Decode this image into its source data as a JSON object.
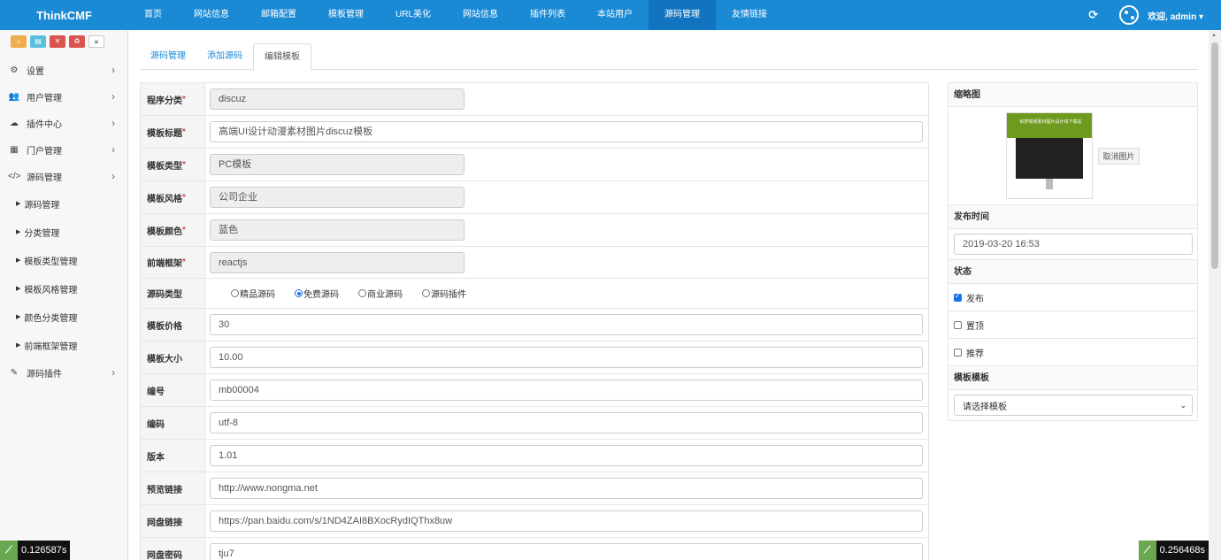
{
  "brand": "ThinkCMF",
  "nav": [
    "首页",
    "网站信息",
    "邮箱配置",
    "模板管理",
    "URL美化",
    "网站信息",
    "插件列表",
    "本站用户",
    "源码管理",
    "友情链接"
  ],
  "nav_active_index": 8,
  "user_menu": {
    "welcome": "欢迎, admin ▾"
  },
  "sidebar": {
    "shortcuts": [
      "home-icon",
      "file-icon",
      "trash-icon",
      "recycle-icon",
      "list-icon"
    ],
    "menu": [
      {
        "label": "设置",
        "icon": "cogs-icon"
      },
      {
        "label": "用户管理",
        "icon": "users-icon"
      },
      {
        "label": "插件中心",
        "icon": "cloud-icon"
      },
      {
        "label": "门户管理",
        "icon": "grid-icon"
      },
      {
        "label": "源码管理",
        "icon": "code-icon"
      }
    ],
    "submenu": [
      "源码管理",
      "分类管理",
      "模板类型管理",
      "模板风格管理",
      "颜色分类管理",
      "前端框架管理"
    ],
    "last_menu": {
      "label": "源码插件",
      "icon": "plug-icon"
    }
  },
  "tabs": [
    "源码管理",
    "添加源码",
    "编辑模板"
  ],
  "form": {
    "category": {
      "label": "程序分类",
      "value": "discuz"
    },
    "title": {
      "label": "模板标题",
      "value": "高端UI设计动漫素材图片discuz模板"
    },
    "type": {
      "label": "模板类型",
      "value": "PC模板"
    },
    "style": {
      "label": "模板风格",
      "value": "公司企业"
    },
    "color": {
      "label": "模板颜色",
      "value": "蓝色"
    },
    "framework": {
      "label": "前端框架",
      "value": "reactjs"
    },
    "source_type": {
      "label": "源码类型",
      "options": [
        "精品源码",
        "免费源码",
        "商业源码",
        "源码插件"
      ],
      "selected": 1
    },
    "price": {
      "label": "模板价格",
      "value": "30"
    },
    "size": {
      "label": "模板大小",
      "value": "10.00"
    },
    "number": {
      "label": "编号",
      "value": "mb00004"
    },
    "encoding": {
      "label": "编码",
      "value": "utf-8"
    },
    "version": {
      "label": "版本",
      "value": "1.01"
    },
    "preview": {
      "label": "预览链接",
      "value": "http://www.nongma.net"
    },
    "pan": {
      "label": "网盘链接",
      "value": "https://pan.baidu.com/s/1ND4ZAI8BXocRydIQThx8uw"
    },
    "pan_pwd": {
      "label": "网盘密码",
      "value": "tju7"
    }
  },
  "panel": {
    "thumb_label": "缩略图",
    "thumb_title": "织梦视频素材图片设计线下载站",
    "cancel_image": "取消图片",
    "publish_label": "发布时间",
    "publish_time": "2019-03-20 16:53",
    "status_label": "状态",
    "status": [
      {
        "label": "发布",
        "checked": true
      },
      {
        "label": "置顶",
        "checked": false
      },
      {
        "label": "推荐",
        "checked": false
      }
    ],
    "template_label": "模板模板",
    "template_select": "请选择模板"
  },
  "timers": {
    "left": "0.126587s",
    "right": "0.256468s"
  }
}
